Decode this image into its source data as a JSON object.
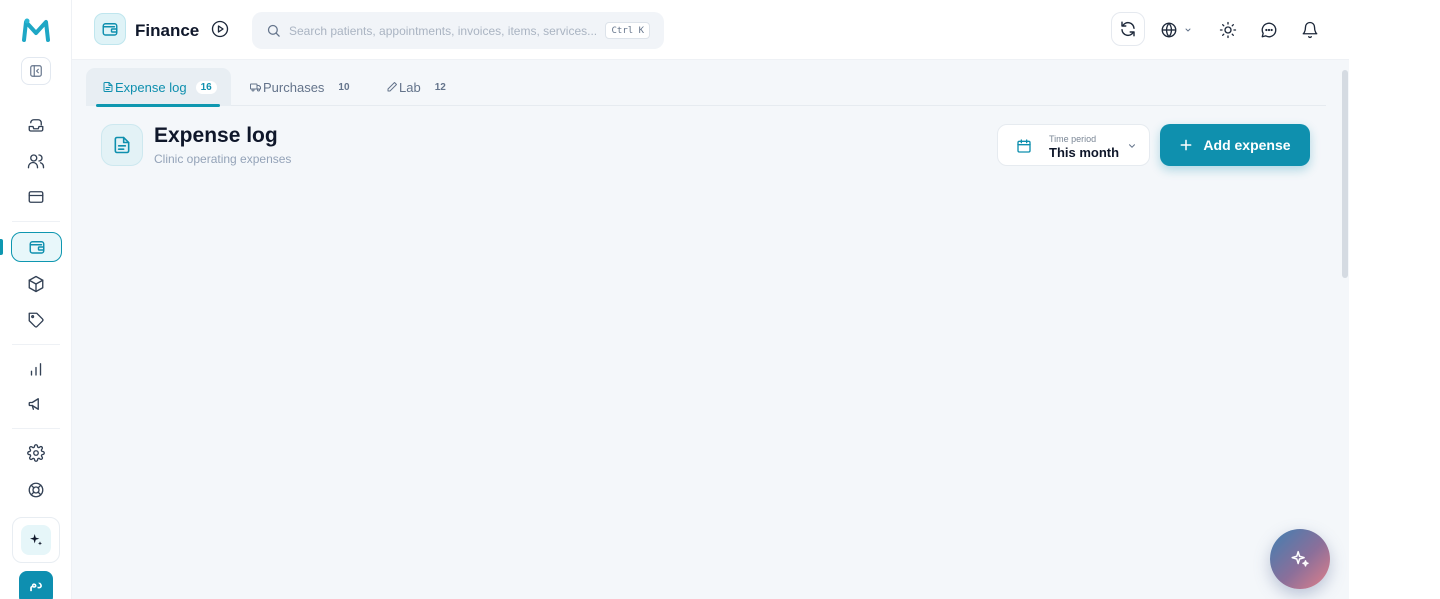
{
  "header": {
    "module_title": "Finance",
    "search_placeholder": "Search patients, appointments, invoices, items, services...",
    "search_shortcut": "Ctrl K",
    "icons": [
      "refresh-icon",
      "globe-icon",
      "chevron-down-icon",
      "sun-icon",
      "chat-icon",
      "bell-icon"
    ]
  },
  "sidebar": {
    "items": [
      "inbox-icon",
      "users-icon",
      "card-icon",
      "wallet-icon",
      "package-icon",
      "tag-icon",
      "chart-icon",
      "megaphone-icon",
      "gear-icon",
      "lifebuoy-icon"
    ],
    "active_item": "wallet-icon",
    "avatar_initials": "دم"
  },
  "tabs": [
    {
      "label": "Expense log",
      "count": "16",
      "active": true
    },
    {
      "label": "Purchases",
      "count": "10",
      "active": false
    },
    {
      "label": "Lab",
      "count": "12",
      "active": false
    }
  ],
  "page": {
    "title": "Expense log",
    "subtitle": "Clinic operating expenses"
  },
  "filters": {
    "period_label": "Time period",
    "period_value": "This month"
  },
  "actions": {
    "add_label": "Add expense"
  },
  "colors": {
    "accent": "#0f90ae",
    "background": "#f4f7fa"
  }
}
